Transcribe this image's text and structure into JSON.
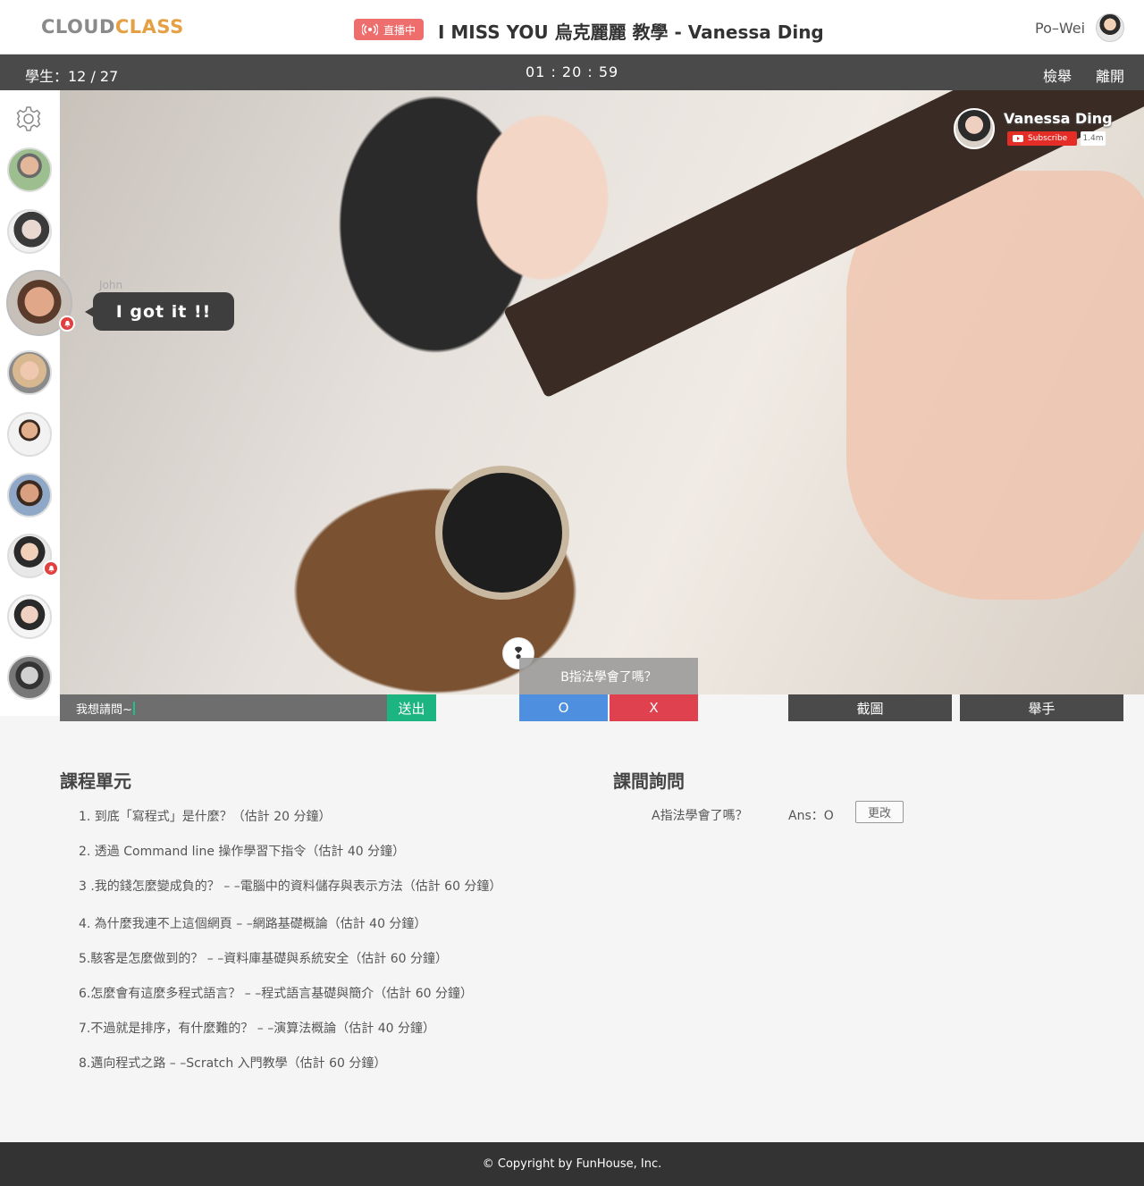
{
  "header": {
    "logo_part1": "CLOUD",
    "logo_part2": "CLASS",
    "live_badge": "直播中",
    "title": "I MISS YOU 烏克麗麗 教學 - Vanessa Ding",
    "username": "Po–Wei"
  },
  "statusbar": {
    "students": "學生：12 / 27",
    "timer": "01 : 20 : 59",
    "report": "檢舉",
    "leave": "離開"
  },
  "video": {
    "channel_name": "Vanessa Ding",
    "subscribe": "Subscribe",
    "sub_count": "1.4m"
  },
  "chat_bubble": {
    "name": "John",
    "message": "I got it !!"
  },
  "quiz": {
    "icon": "❢",
    "question": "B指法學會了嗎？",
    "option_o": "O",
    "option_x": "X"
  },
  "controls": {
    "input_value": "我想請問~",
    "send": "送出",
    "screenshot": "截圖",
    "raise_hand": "舉手"
  },
  "units": {
    "title": "課程單元",
    "items": [
      "1. 到底「寫程式」是什麼？（估計 20 分鐘）",
      "2. 透過 Command line 操作學習下指令（估計 40 分鐘）",
      "3 .我的錢怎麼變成負的？ – –電腦中的資料儲存與表示方法（估計 60 分鐘）",
      "4. 為什麼我連不上這個網頁 – –網路基礎概論（估計 40 分鐘）",
      "5.駭客是怎麼做到的？ – –資料庫基礎與系統安全（估計 60 分鐘）",
      "6.怎麼會有這麼多程式語言？ – –程式語言基礎與簡介（估計 60 分鐘）",
      "7.不過就是排序，有什麼難的？ – –演算法概論（估計 40 分鐘）",
      "8.邁向程式之路 – –Scratch 入門教學（估計 60 分鐘）"
    ]
  },
  "inquiry": {
    "title": "課間詢問",
    "question": "A指法學會了嗎？",
    "answer": "Ans：O",
    "change": "更改"
  },
  "footer": {
    "copyright": "© Copyright by FunHouse, Inc."
  },
  "colors": {
    "logo_cloud": "#8a8a8a",
    "logo_class": "#e6a044",
    "live": "#ee6e6e",
    "send": "#1cb481",
    "option_o": "#4f8fdf",
    "option_x": "#e0414f",
    "dark_bar": "#4a4a4a"
  }
}
